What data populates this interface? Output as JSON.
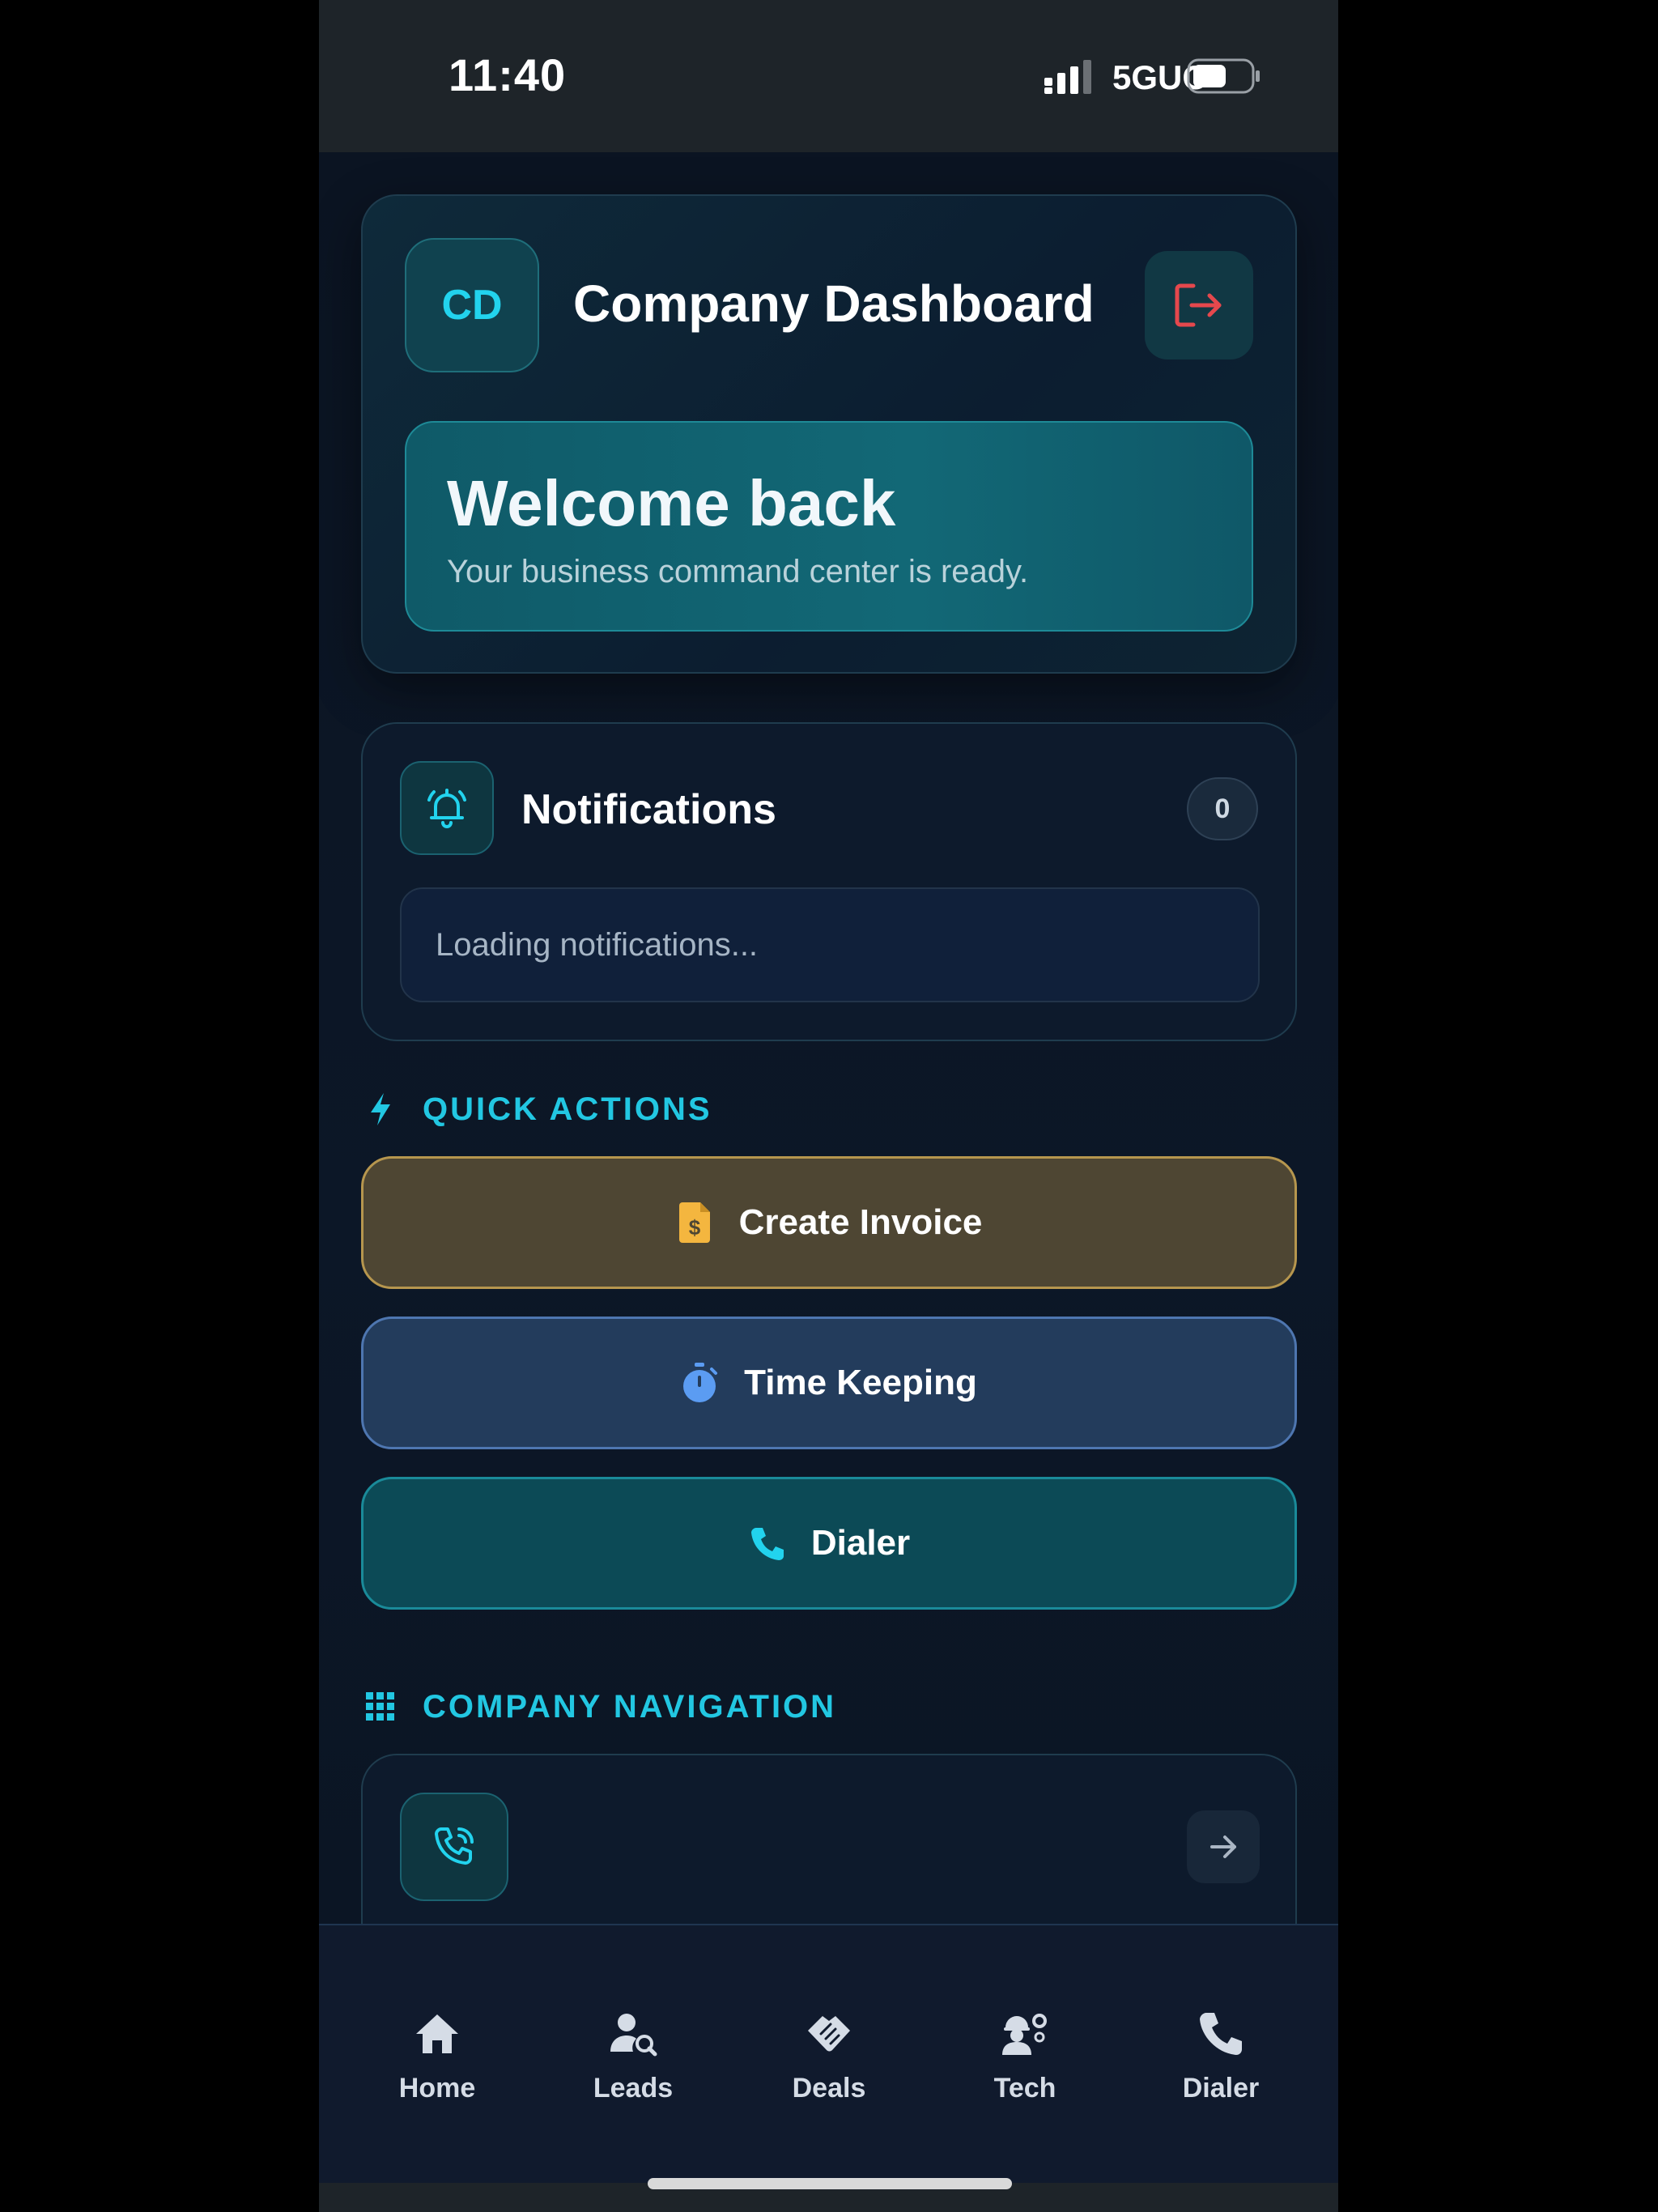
{
  "status_bar": {
    "time": "11:40",
    "network": "5GUC"
  },
  "header": {
    "badge_initials": "CD",
    "title": "Company Dashboard",
    "welcome_title": "Welcome back",
    "welcome_subtitle": "Your business command center is ready."
  },
  "notifications": {
    "title": "Notifications",
    "count": "0",
    "loading_text": "Loading notifications..."
  },
  "quick_actions": {
    "label": "QUICK ACTIONS",
    "buttons": [
      {
        "label": "Create Invoice",
        "icon": "invoice-icon",
        "color": "#4e4633"
      },
      {
        "label": "Time Keeping",
        "icon": "stopwatch-icon",
        "color": "#233c5c"
      },
      {
        "label": "Dialer",
        "icon": "phone-icon",
        "color": "#0c4a56"
      }
    ]
  },
  "company_navigation": {
    "label": "COMPANY NAVIGATION"
  },
  "tabbar": {
    "items": [
      {
        "label": "Home",
        "icon": "home-icon"
      },
      {
        "label": "Leads",
        "icon": "leads-icon"
      },
      {
        "label": "Deals",
        "icon": "handshake-icon"
      },
      {
        "label": "Tech",
        "icon": "technician-icon"
      },
      {
        "label": "Dialer",
        "icon": "phone-icon"
      }
    ]
  },
  "colors": {
    "accent": "#22d3ee",
    "logout": "#e5484d",
    "background": "#0b1626"
  }
}
